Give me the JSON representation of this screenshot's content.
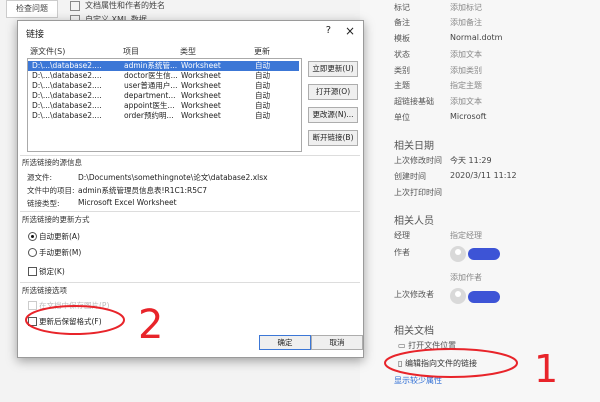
{
  "background": {
    "top_button": "检查问题",
    "top_items": [
      "文档属性和作者的姓名",
      "自定义 XML 数据"
    ]
  },
  "props": [
    {
      "label": "标记",
      "value": "添加标记",
      "muted": true
    },
    {
      "label": "备注",
      "value": "添加备注",
      "muted": true
    },
    {
      "label": "模板",
      "value": "Normal.dotm",
      "muted": false
    },
    {
      "label": "状态",
      "value": "添加文本",
      "muted": true
    },
    {
      "label": "类别",
      "value": "添加类别",
      "muted": true
    },
    {
      "label": "主题",
      "value": "指定主题",
      "muted": true
    },
    {
      "label": "超链接基础",
      "value": "添加文本",
      "muted": true
    },
    {
      "label": "单位",
      "value": "Microsoft",
      "muted": false
    }
  ],
  "dates": {
    "title": "相关日期",
    "rows": [
      {
        "label": "上次修改时间",
        "value": "今天 11:29"
      },
      {
        "label": "创建时间",
        "value": "2020/3/11 11:12"
      },
      {
        "label": "上次打印时间",
        "value": ""
      }
    ]
  },
  "people": {
    "title": "相关人员",
    "manager_label": "经理",
    "manager_value": "指定经理",
    "author_label": "作者",
    "add_author": "添加作者",
    "last_modified_label": "上次修改者"
  },
  "docs": {
    "title": "相关文档",
    "open_location": "打开文件位置",
    "edit_links": "编辑指向文件的链接",
    "show_fewer": "显示较少属性"
  },
  "dialog": {
    "title": "链接",
    "help": "?",
    "close": "×",
    "columns": [
      "源文件(S)",
      "项目",
      "类型",
      "更新"
    ],
    "rows": [
      {
        "source": "D:\\...\\database2....",
        "item": "admin系统管...",
        "type": "Worksheet",
        "update": "自动",
        "selected": true
      },
      {
        "source": "D:\\...\\database2....",
        "item": "doctor医生信...",
        "type": "Worksheet",
        "update": "自动",
        "selected": false
      },
      {
        "source": "D:\\...\\database2....",
        "item": "user普通用户...",
        "type": "Worksheet",
        "update": "自动",
        "selected": false
      },
      {
        "source": "D:\\...\\database2....",
        "item": "department...",
        "type": "Worksheet",
        "update": "自动",
        "selected": false
      },
      {
        "source": "D:\\...\\database2....",
        "item": "appoint医生...",
        "type": "Worksheet",
        "update": "自动",
        "selected": false
      },
      {
        "source": "D:\\...\\database2....",
        "item": "order预约明...",
        "type": "Worksheet",
        "update": "自动",
        "selected": false
      }
    ],
    "buttons": {
      "update_now": "立即更新(U)",
      "open_source": "打开源(O)",
      "change_source": "更改源(N)...",
      "break_link": "断开链接(B)"
    },
    "source_info": {
      "heading": "所选链接的源信息",
      "source_label": "源文件:",
      "source_value": "D:\\Documents\\somethingnote\\论文\\database2.xlsx",
      "item_label": "文件中的项目:",
      "item_value": "admin系统管理员信息表!R1C1:R5C7",
      "type_label": "链接类型:",
      "type_value": "Microsoft Excel Worksheet"
    },
    "update_method": {
      "heading": "所选链接的更新方式",
      "auto": "自动更新(A)",
      "manual": "手动更新(M)",
      "locked": "锁定(K)"
    },
    "options": {
      "heading": "所选链接选项",
      "save_picture": "在文档中保存图片(P)",
      "keep_format": "更新后保留格式(F)"
    },
    "ok": "确定",
    "cancel": "取消"
  },
  "annotations": {
    "label_1": "1",
    "label_2": "2",
    "color": "#e8242a"
  }
}
